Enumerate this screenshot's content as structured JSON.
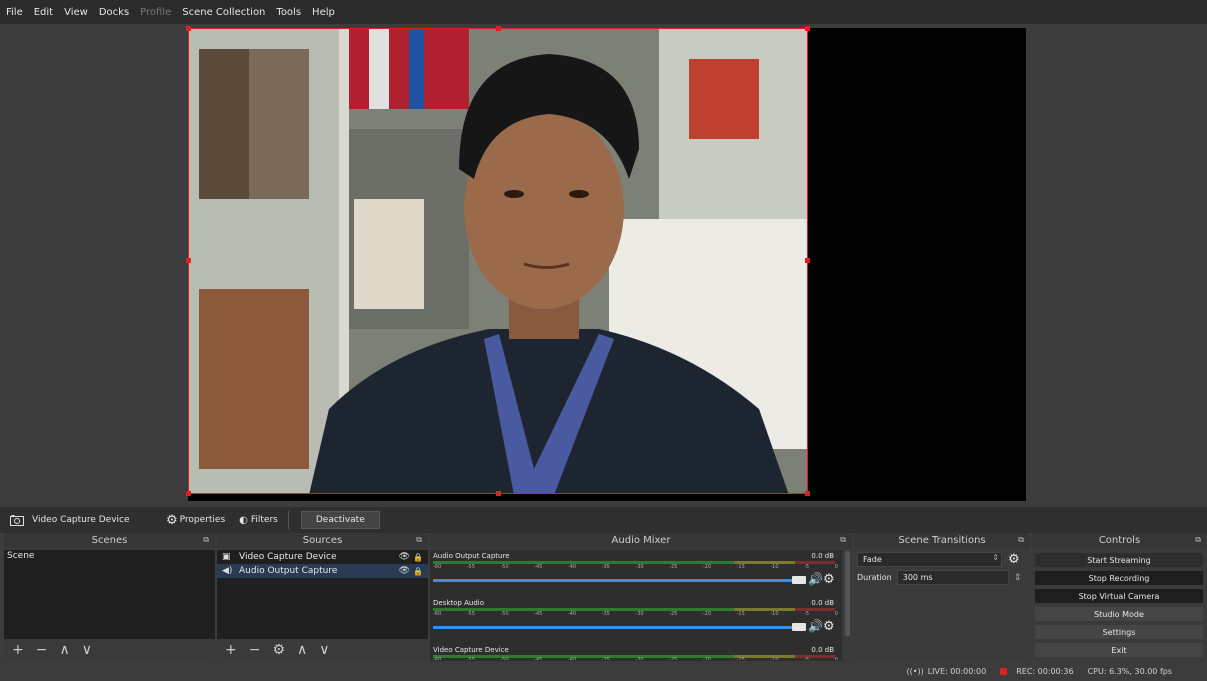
{
  "menu": {
    "items": [
      {
        "label": "File",
        "enabled": true
      },
      {
        "label": "Edit",
        "enabled": true
      },
      {
        "label": "View",
        "enabled": true
      },
      {
        "label": "Docks",
        "enabled": true
      },
      {
        "label": "Profile",
        "enabled": false
      },
      {
        "label": "Scene Collection",
        "enabled": true
      },
      {
        "label": "Tools",
        "enabled": true
      },
      {
        "label": "Help",
        "enabled": true
      }
    ]
  },
  "source_toolbar": {
    "source_name": "Video Capture Device",
    "properties_label": "Properties",
    "filters_label": "Filters",
    "deactivate_label": "Deactivate"
  },
  "scenes": {
    "title": "Scenes",
    "items": [
      "Scene"
    ]
  },
  "sources": {
    "title": "Sources",
    "items": [
      {
        "label": "Video Capture Device",
        "icon": "camera-icon",
        "selected": false
      },
      {
        "label": "Audio Output Capture",
        "icon": "speaker-icon",
        "selected": true
      }
    ]
  },
  "mixer": {
    "title": "Audio Mixer",
    "ticks": [
      "-60",
      "-55",
      "-50",
      "-45",
      "-40",
      "-35",
      "-30",
      "-25",
      "-20",
      "-15",
      "-10",
      "-5",
      "0"
    ],
    "channels": [
      {
        "name": "Audio Output Capture",
        "db": "0.0 dB"
      },
      {
        "name": "Desktop Audio",
        "db": "0.0 dB"
      },
      {
        "name": "Video Capture Device",
        "db": "0.0 dB"
      }
    ]
  },
  "transitions": {
    "title": "Scene Transitions",
    "selected": "Fade",
    "duration_label": "Duration",
    "duration_value": "300 ms"
  },
  "controls": {
    "title": "Controls",
    "buttons": [
      "Start Streaming",
      "Stop Recording",
      "Stop Virtual Camera",
      "Studio Mode",
      "Settings",
      "Exit"
    ]
  },
  "status": {
    "live": "LIVE: 00:00:00",
    "rec": "REC: 00:00:36",
    "cpu": "CPU: 6.3%, 30.00 fps"
  },
  "colors": {
    "selection_border": "#e02020",
    "accent_blue": "#3a8ee6",
    "recording_red": "#e02020"
  }
}
